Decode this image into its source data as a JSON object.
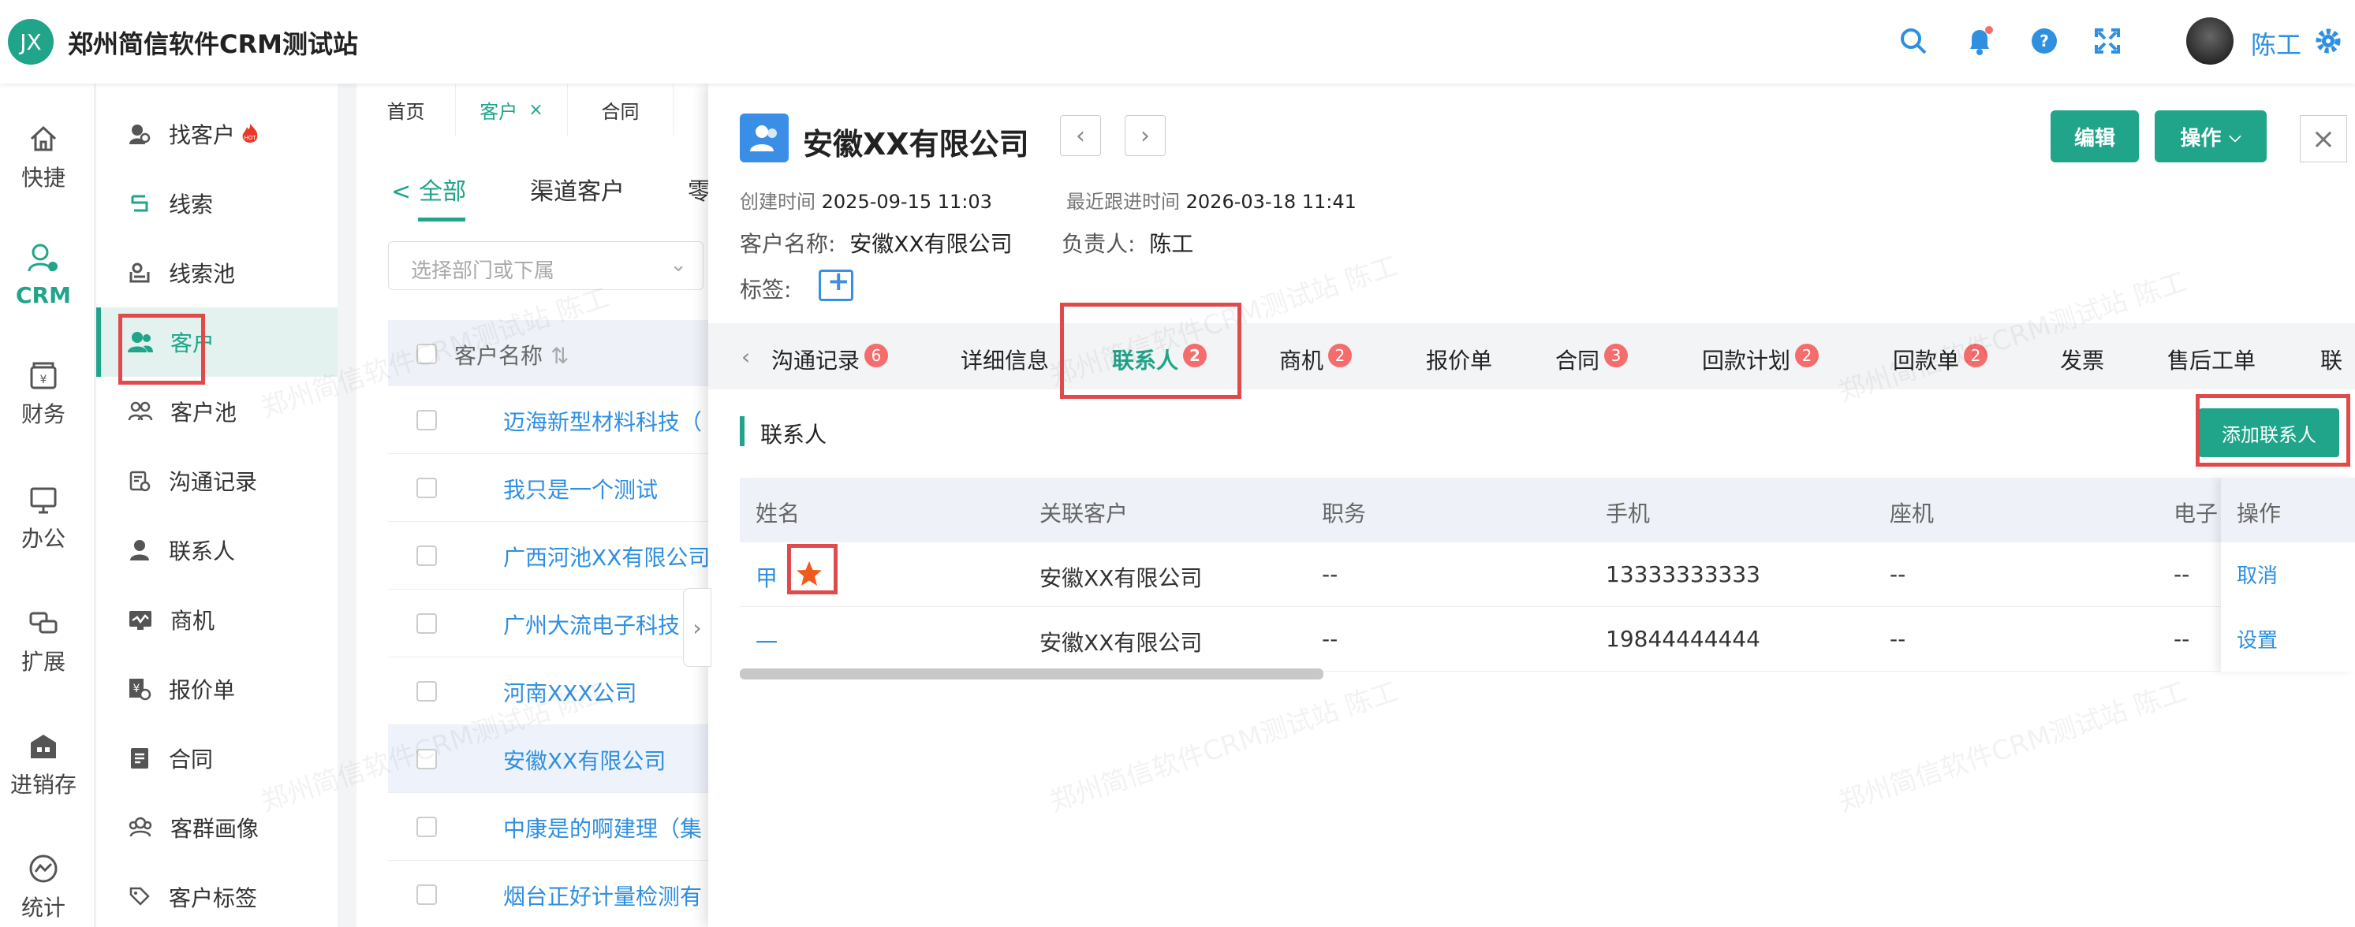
{
  "app": {
    "logo_text": "JX",
    "title": "郑州简信软件CRM测试站",
    "user_name": "陈工"
  },
  "nav": {
    "items": [
      "快捷",
      "CRM",
      "财务",
      "办公",
      "扩展",
      "进销存",
      "统计"
    ],
    "active": "CRM"
  },
  "submenu": {
    "items": [
      "找客户",
      "线索",
      "线索池",
      "客户",
      "客户池",
      "沟通记录",
      "联系人",
      "商机",
      "报价单",
      "合同",
      "客群画像",
      "客户标签"
    ],
    "hot_badge": "HOT",
    "active": "客户"
  },
  "list": {
    "tabs": [
      "首页",
      "客户",
      "合同"
    ],
    "segment": [
      "全部",
      "渠道客户",
      "零"
    ],
    "dept_placeholder": "选择部门或下属",
    "column_header": "客户名称",
    "rows": [
      "迈海新型材料科技（",
      "我只是一个测试",
      "广西河池XX有限公司",
      "广州大流电子科技",
      "河南XXX公司",
      "安徽XX有限公司",
      "中康是的啊建理（集",
      "烟台正好计量检测有"
    ]
  },
  "detail": {
    "title": "安徽XX有限公司",
    "buttons": {
      "edit": "编辑",
      "ops": "操作"
    },
    "created_label": "创建时间",
    "created_value": "2025-09-15 11:03",
    "followup_label": "最近跟进时间",
    "followup_value": "2026-03-18 11:41",
    "customer_label": "客户名称:",
    "customer_value": "安徽XX有限公司",
    "owner_label": "负责人:",
    "owner_value": "陈工",
    "tag_label": "标签:",
    "tabs": [
      {
        "label": "沟通记录",
        "badge": "6"
      },
      {
        "label": "详细信息",
        "badge": ""
      },
      {
        "label": "联系人",
        "badge": "2"
      },
      {
        "label": "商机",
        "badge": "2"
      },
      {
        "label": "报价单",
        "badge": ""
      },
      {
        "label": "合同",
        "badge": "3"
      },
      {
        "label": "回款计划",
        "badge": "2"
      },
      {
        "label": "回款单",
        "badge": "2"
      },
      {
        "label": "发票",
        "badge": ""
      },
      {
        "label": "售后工单",
        "badge": ""
      },
      {
        "label": "联",
        "badge": ""
      }
    ],
    "active_tab": "联系人",
    "section_title": "联系人",
    "add_contact": "添加联系人",
    "columns": [
      "姓名",
      "关联客户",
      "职务",
      "手机",
      "座机",
      "电子",
      "操作"
    ],
    "rows": [
      {
        "name": "甲",
        "customer": "安徽XX有限公司",
        "title": "--",
        "mobile": "13333333333",
        "phone": "--",
        "email": "--",
        "action": "取消",
        "starred": true
      },
      {
        "name": "一",
        "customer": "安徽XX有限公司",
        "title": "--",
        "mobile": "19844444444",
        "phone": "--",
        "email": "--",
        "action": "设置",
        "starred": false
      }
    ]
  },
  "watermark": "郑州简信软件CRM测试站 陈工",
  "colors": {
    "primary": "#20a48a",
    "link": "#2f8fe0",
    "badge": "#f56c6c",
    "highlight": "#e04a4a",
    "star": "#f05a1a"
  }
}
